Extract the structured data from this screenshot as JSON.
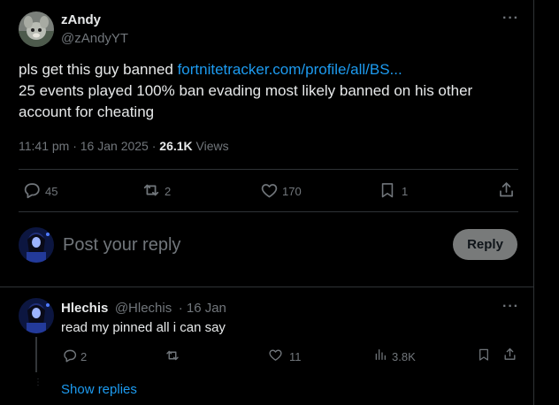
{
  "tweet": {
    "author_name": "zAndy",
    "author_handle": "@zAndyYT",
    "more_icon": "more-icon",
    "text_prefix": "pls get this guy banned ",
    "link_text": "fortnitetracker.com/profile/all/BS...",
    "text_line2": "25 events played 100% ban evading most likely banned on his other",
    "text_line3": "account for cheating",
    "timestamp": "11:41 pm · 16 Jan 2025 · ",
    "views_count": "26.1K",
    "views_label": " Views",
    "actions": {
      "replies": "45",
      "reposts": "2",
      "likes": "170",
      "bookmarks": "1"
    }
  },
  "composer": {
    "placeholder": "Post your reply",
    "button_label": "Reply"
  },
  "reply": {
    "author_name": "Hlechis",
    "author_handle": "@Hlechis",
    "date": "· 16 Jan",
    "text": "read my pinned all i can say",
    "actions": {
      "replies": "2",
      "reposts": "",
      "likes": "11",
      "views": "3.8K"
    },
    "show_replies": "Show replies"
  },
  "colors": {
    "background": "#000000",
    "text": "#e7e9ea",
    "muted": "#71767b",
    "link": "#1d9bf0",
    "divider": "#2f3336",
    "reply_button_bg": "#787a7a"
  }
}
